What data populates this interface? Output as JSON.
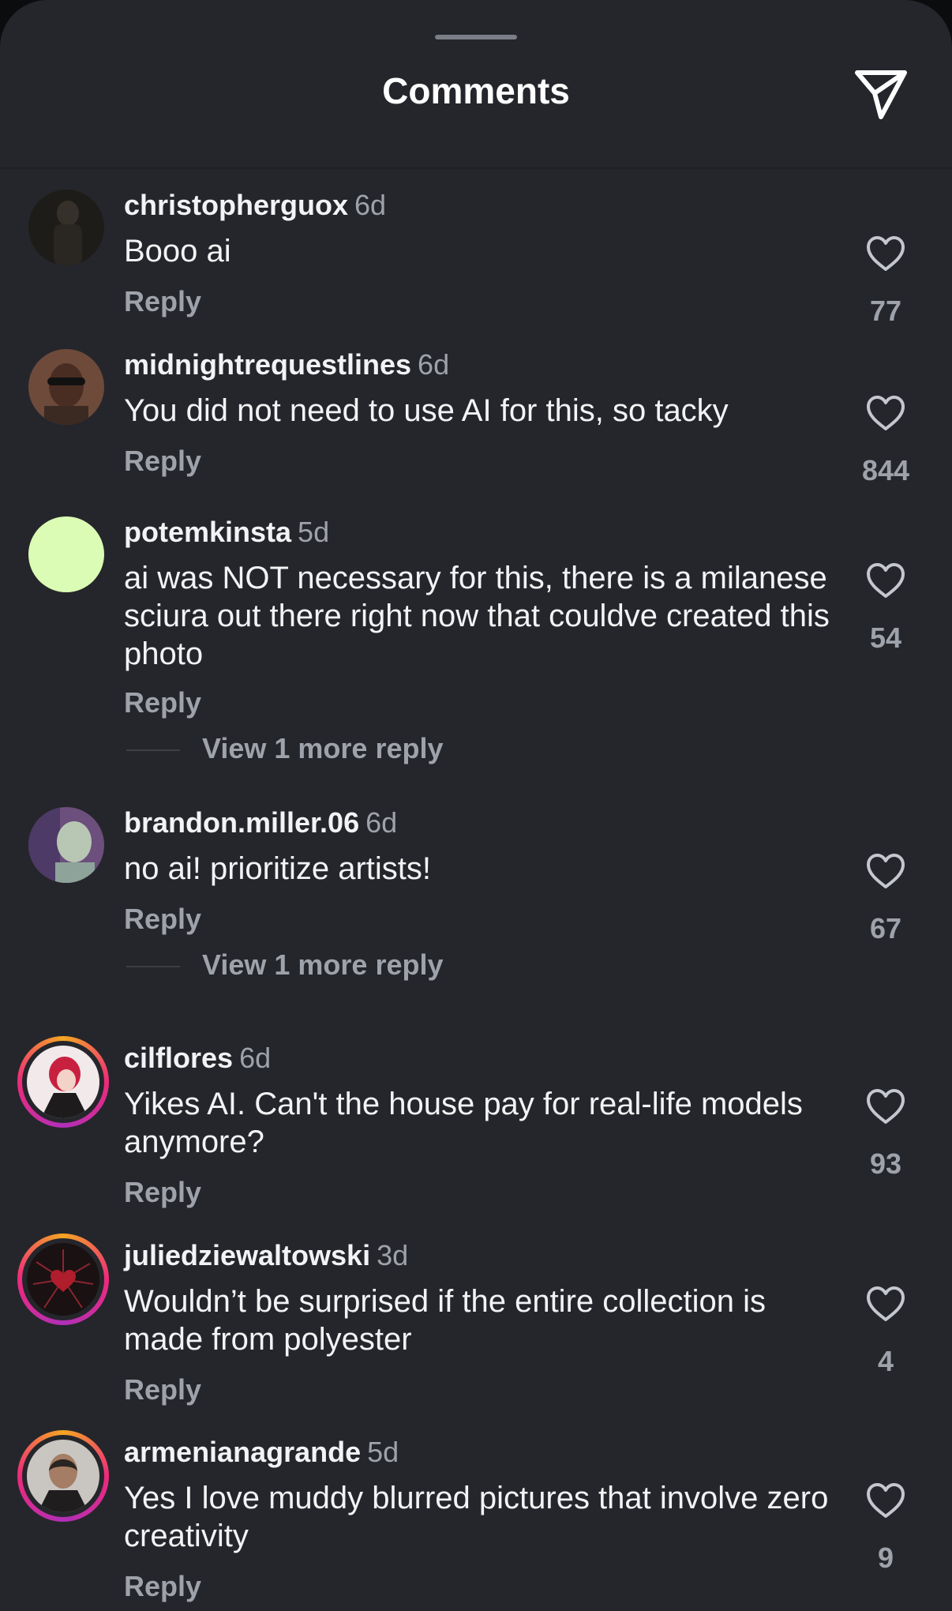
{
  "sheet": {
    "title": "Comments",
    "send_icon": "send-paper-plane-icon",
    "heart_icon": "heart-outline-icon"
  },
  "comments": [
    {
      "username": "christopherguox",
      "time": "6d",
      "text": "Booo ai",
      "reply_label": "Reply",
      "likes": "77",
      "avatar_color": "#1e1c19"
    },
    {
      "username": "midnightrequestlines",
      "time": "6d",
      "text": "You did not need to use AI for this, so tacky",
      "reply_label": "Reply",
      "likes": "844",
      "avatar_color": "#6d4a3a"
    },
    {
      "username": "potemkinsta",
      "time": "5d",
      "text": "ai was NOT necessary for this, there is a milanese sciura out there right now that couldve created this photo",
      "reply_label": "Reply",
      "likes": "54",
      "view_more": "View 1 more reply",
      "avatar_color": "#dbfcb4"
    },
    {
      "username": "brandon.miller.06",
      "time": "6d",
      "text": "no ai! prioritize artists!",
      "reply_label": "Reply",
      "likes": "67",
      "view_more": "View 1 more reply",
      "avatar_color": "#8a7fa0"
    },
    {
      "username": "cilflores",
      "time": "6d",
      "text": "Yikes AI. Can't the house pay for real-life models anymore?",
      "reply_label": "Reply",
      "likes": "93",
      "avatar_color": "#f1e9ea"
    },
    {
      "username": "juliedziewaltowski",
      "time": "3d",
      "text": "Wouldn’t be surprised if the entire collection is made from polyester",
      "reply_label": "Reply",
      "likes": "4",
      "avatar_color": "#1a1112"
    },
    {
      "username": "armenianagrande",
      "time": "5d",
      "text": "Yes I love muddy blurred pictures that involve zero creativity",
      "reply_label": "Reply",
      "likes": "9",
      "avatar_color": "#c9c6c2"
    }
  ]
}
